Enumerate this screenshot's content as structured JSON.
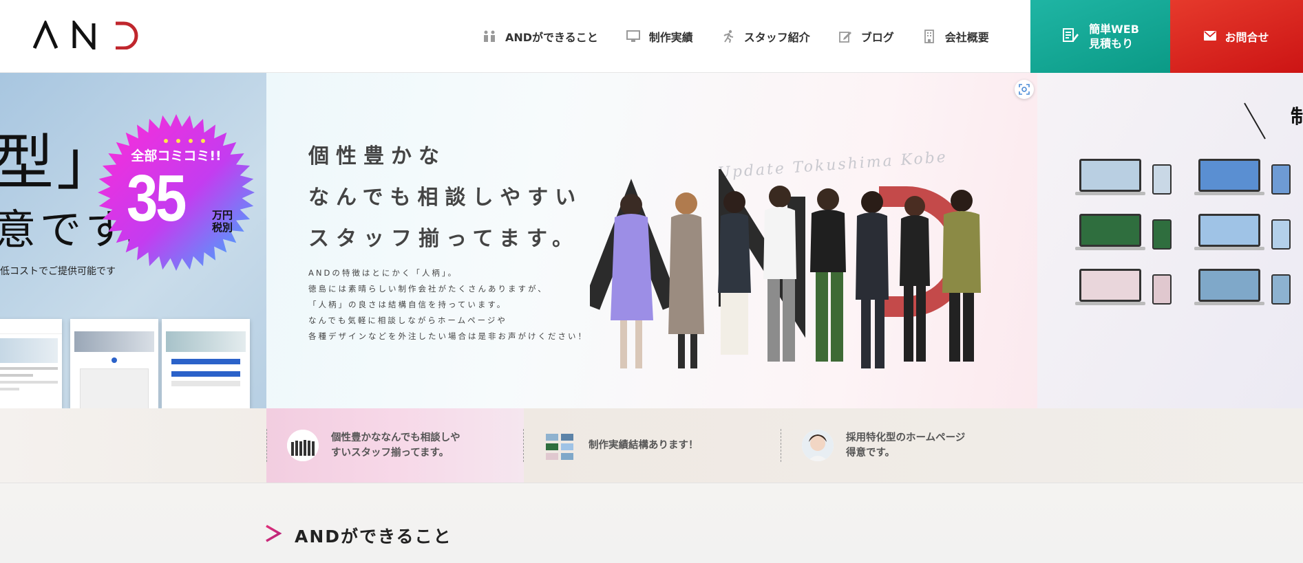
{
  "header": {
    "logo_text": "AND",
    "nav": [
      {
        "label": "ANDができること",
        "icon": "people-icon"
      },
      {
        "label": "制作実績",
        "icon": "monitor-icon"
      },
      {
        "label": "スタッフ紹介",
        "icon": "running-person-icon"
      },
      {
        "label": "ブログ",
        "icon": "pencil-icon"
      },
      {
        "label": "会社概要",
        "icon": "building-icon"
      }
    ],
    "estimate_label_1": "簡単WEB",
    "estimate_label_2": "見積もり",
    "contact_label": "お問合せ"
  },
  "hero": {
    "left": {
      "big_type": "型」",
      "big_sub": "意です。",
      "cost_line": "低コストでご提供可能です",
      "burst_top": "全部コミコミ!!",
      "burst_number": "35",
      "burst_unit_1": "万円",
      "burst_unit_2": "税別"
    },
    "main": {
      "catch_lines": [
        "個性豊かな",
        "なんでも相談しやすい",
        "スタッフ揃ってます。"
      ],
      "desc_lines": [
        "ANDの特徴はとにかく「人柄」。",
        "徳島には素晴らしい制作会社がたくさんありますが、",
        "「人柄」の良さは結構自信を持っています。",
        "なんでも気軽に相談しながらホームページや",
        "各種デザインなどを外注したい場合は是非お声がけください！"
      ],
      "script_text": "Update Tokushima Kobe"
    },
    "right": {
      "heading_char": "制"
    }
  },
  "strip": {
    "tabs": [
      {
        "line1": "個性豊かななんでも相談しや",
        "line2": "すいスタッフ揃ってます。"
      },
      {
        "line1": "制作実績結構あります！",
        "line2": ""
      },
      {
        "line1": "採用特化型のホームページ",
        "line2": "得意です。"
      }
    ]
  },
  "section": {
    "title": "ANDができること"
  },
  "colors": {
    "teal": "#1fb5a4",
    "red": "#e0261e",
    "accent_pink": "#d6247a"
  }
}
